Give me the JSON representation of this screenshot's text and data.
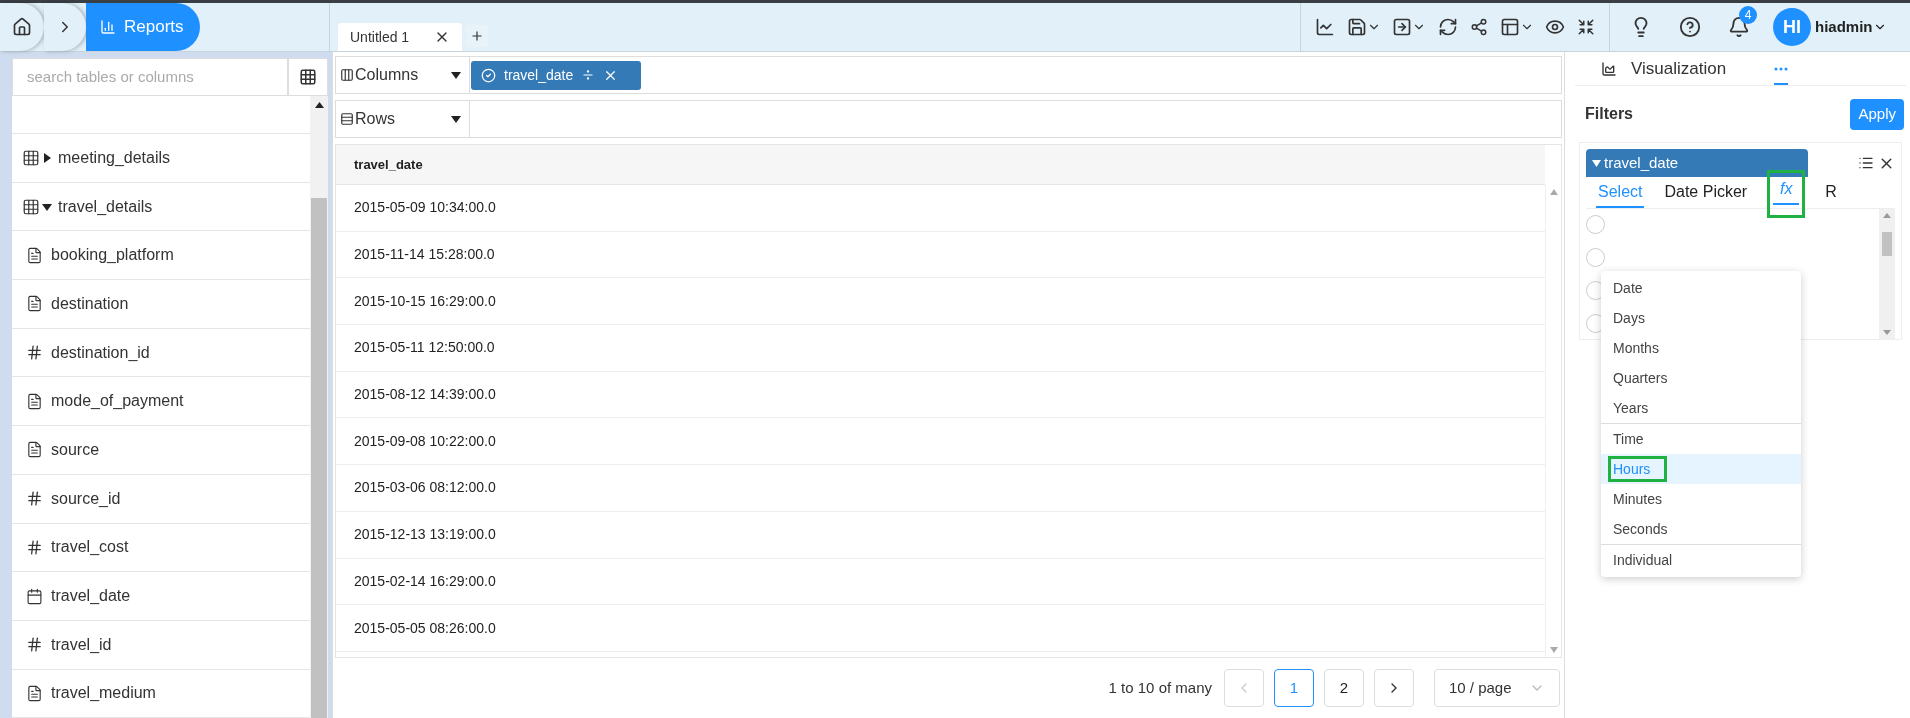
{
  "breadcrumb": {
    "current": "Reports"
  },
  "tabs": [
    {
      "label": "Untitled 1",
      "selected": true
    }
  ],
  "account": {
    "notifications": "4",
    "avatar": "HI",
    "user": "hiadmin"
  },
  "sidebar": {
    "search_placeholder": "search tables or columns",
    "items": [
      {
        "label": "meeting_details",
        "kind": "table",
        "expanded": false
      },
      {
        "label": "travel_details",
        "kind": "table",
        "expanded": true,
        "children": [
          {
            "label": "booking_platform",
            "kind": "text"
          },
          {
            "label": "destination",
            "kind": "text"
          },
          {
            "label": "destination_id",
            "kind": "number"
          },
          {
            "label": "mode_of_payment",
            "kind": "text"
          },
          {
            "label": "source",
            "kind": "text"
          },
          {
            "label": "source_id",
            "kind": "number"
          },
          {
            "label": "travel_cost",
            "kind": "number"
          },
          {
            "label": "travel_date",
            "kind": "date"
          },
          {
            "label": "travel_id",
            "kind": "number"
          },
          {
            "label": "travel_medium",
            "kind": "text"
          }
        ]
      }
    ]
  },
  "columns_shelf": {
    "label": "Columns",
    "chips": [
      "travel_date"
    ]
  },
  "rows_shelf": {
    "label": "Rows"
  },
  "table": {
    "columns": [
      "travel_date"
    ],
    "rows": [
      [
        "2015-05-09 10:34:00.0"
      ],
      [
        "2015-11-14 15:28:00.0"
      ],
      [
        "2015-10-15 16:29:00.0"
      ],
      [
        "2015-05-11 12:50:00.0"
      ],
      [
        "2015-08-12 14:39:00.0"
      ],
      [
        "2015-09-08 10:22:00.0"
      ],
      [
        "2015-03-06 08:12:00.0"
      ],
      [
        "2015-12-13 13:19:00.0"
      ],
      [
        "2015-02-14 16:29:00.0"
      ],
      [
        "2015-05-05 08:26:00.0"
      ]
    ]
  },
  "pagination": {
    "summary": "1 to 10 of many",
    "prev_disabled": true,
    "pages": [
      {
        "label": "1",
        "selected": true
      },
      {
        "label": "2",
        "selected": false
      }
    ],
    "page_size": "10 / page"
  },
  "right_panel": {
    "tabs": [
      {
        "kind": "chart",
        "label": "Visualization",
        "selected": false
      },
      {
        "kind": "more",
        "selected": true
      }
    ],
    "title": "Filters",
    "apply": "Apply",
    "filter": {
      "field": "travel_date",
      "expanded": true,
      "options": [
        {
          "selected": false
        },
        {
          "selected": false
        },
        {
          "selected": false
        },
        {
          "selected": false
        }
      ],
      "tabs": [
        {
          "label": "Select",
          "selected": true,
          "italic": false,
          "annotated": false
        },
        {
          "label": "Date Picker",
          "selected": false,
          "italic": false,
          "annotated": false
        },
        {
          "label": "fx",
          "selected": true,
          "italic": true,
          "annotated": true
        },
        {
          "label": "R",
          "selected": false,
          "italic": false,
          "annotated": false
        }
      ],
      "menu": [
        [
          {
            "label": "Date",
            "selected": false,
            "annotated": false
          },
          {
            "label": "Days",
            "selected": false,
            "annotated": false
          },
          {
            "label": "Months",
            "selected": false,
            "annotated": false
          },
          {
            "label": "Quarters",
            "selected": false,
            "annotated": false
          },
          {
            "label": "Years",
            "selected": false,
            "annotated": false
          }
        ],
        [
          {
            "label": "Time",
            "selected": false,
            "annotated": false
          },
          {
            "label": "Hours",
            "selected": true,
            "annotated": true
          },
          {
            "label": "Minutes",
            "selected": false,
            "annotated": false
          },
          {
            "label": "Seconds",
            "selected": false,
            "annotated": false
          }
        ],
        [
          {
            "label": "Individual",
            "selected": false,
            "annotated": false
          }
        ]
      ]
    }
  }
}
